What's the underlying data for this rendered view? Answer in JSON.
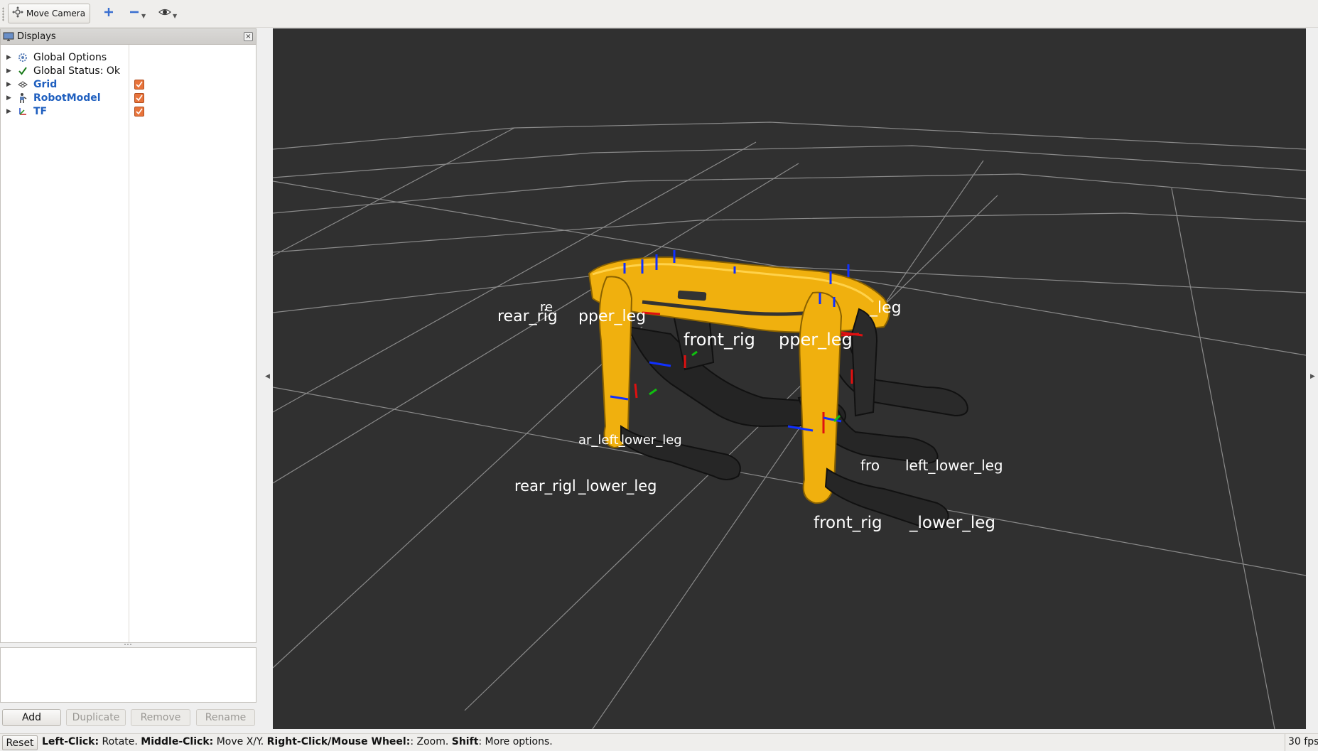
{
  "toolbar": {
    "move_camera_label": "Move Camera",
    "tools": [
      "add-tool-icon",
      "remove-tool-icon",
      "view-tool-icon"
    ]
  },
  "displays_panel": {
    "title": "Displays",
    "close_symbol": "×",
    "items": [
      {
        "label": "Global Options",
        "icon": "gear-icon",
        "checkable": false,
        "highlighted": false
      },
      {
        "label": "Global Status: Ok",
        "icon": "checkmark-icon",
        "checkable": false,
        "highlighted": false
      },
      {
        "label": "Grid",
        "icon": "grid-icon",
        "checkable": true,
        "checked": true,
        "highlighted": true
      },
      {
        "label": "RobotModel",
        "icon": "robot-icon",
        "checkable": true,
        "checked": true,
        "highlighted": true
      },
      {
        "label": "TF",
        "icon": "axes-icon",
        "checkable": true,
        "checked": true,
        "highlighted": true
      }
    ],
    "buttons": {
      "add": "Add",
      "duplicate": "Duplicate",
      "remove": "Remove",
      "rename": "Rename"
    }
  },
  "viewport": {
    "background_color": "#303030",
    "grid_color": "#a0a0a0",
    "robot_color": "#f0b00e",
    "tf_labels": [
      "rear_rig",
      "pper_leg",
      "re",
      "_leg",
      "front_rig",
      "pper_leg",
      "ar_left_",
      "ar_left_lower_leg",
      "rear_rigl",
      "_lower_leg",
      "fro",
      "left_lower_leg",
      "front_rig",
      "_lower_leg"
    ]
  },
  "statusbar": {
    "reset_label": "Reset",
    "hint": [
      {
        "key": "Left-Click:",
        "text": " Rotate. "
      },
      {
        "key": "Middle-Click:",
        "text": " Move X/Y. "
      },
      {
        "key": "Right-Click/Mouse Wheel:",
        "text": ": Zoom. "
      },
      {
        "key": "Shift",
        "text": ": More options."
      }
    ],
    "fps": "30 fps"
  }
}
